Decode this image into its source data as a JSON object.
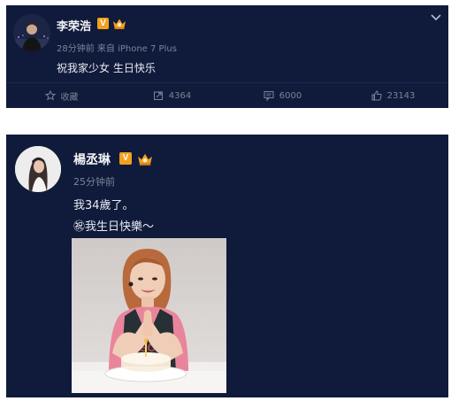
{
  "post1": {
    "author": "李荣浩",
    "meta": "28分钟前 来自 iPhone 7 Plus",
    "text": "祝我家少女 生日快乐",
    "actions": {
      "favorite": "收藏",
      "repost": "4364",
      "comment": "6000",
      "like": "23143"
    }
  },
  "post2": {
    "author": "楊丞琳",
    "meta": "25分钟前",
    "line1": "我34歲了。",
    "line2": "㊗我生日快樂～"
  },
  "colors": {
    "card_bg": "#101a3a",
    "verified_badge": "#f2a01e",
    "meta_text": "#7c8399"
  },
  "icons": [
    "verified-badge-icon",
    "crown-badge-icon",
    "chevron-down-icon",
    "star-icon",
    "repost-icon",
    "comment-icon",
    "thumbs-up-icon"
  ]
}
